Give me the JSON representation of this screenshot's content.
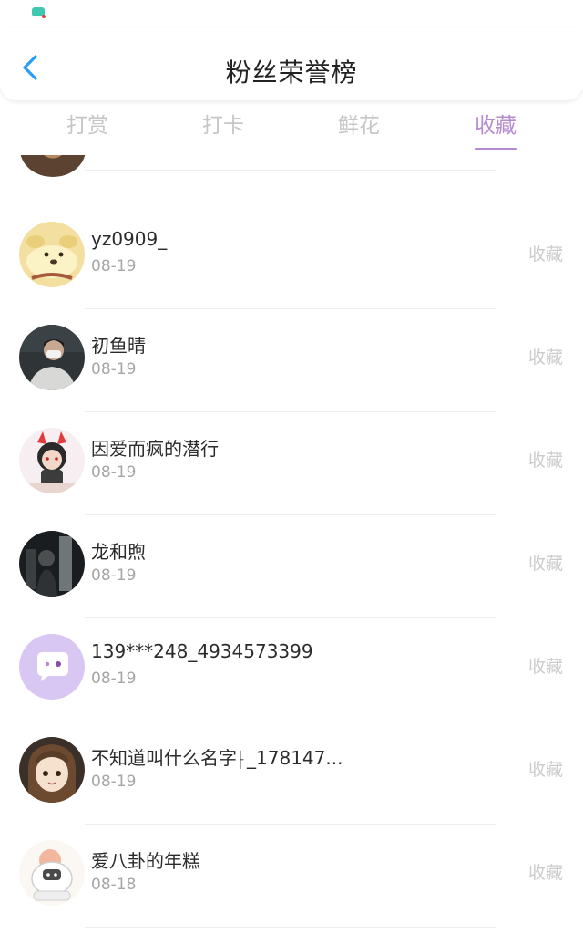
{
  "header": {
    "title": "粉丝荣誉榜"
  },
  "tabs": [
    {
      "label": "打赏",
      "active": false
    },
    {
      "label": "打卡",
      "active": false
    },
    {
      "label": "鲜花",
      "active": false
    },
    {
      "label": "收藏",
      "active": true
    }
  ],
  "colors": {
    "accent": "#b68ad0",
    "tab_inactive": "#c6c6c6",
    "date_text": "#a6a6a6",
    "action_text": "#cccccc"
  },
  "list": {
    "items": [
      {
        "name": "yz0909_",
        "date": "08-19",
        "action": "收藏",
        "avatar": "cartoon-dog-avatar"
      },
      {
        "name": "初鱼晴",
        "date": "08-19",
        "action": "收藏",
        "avatar": "masked-person-avatar"
      },
      {
        "name": "因爱而疯的潜行",
        "date": "08-19",
        "action": "收藏",
        "avatar": "devil-horn-avatar"
      },
      {
        "name": "龙和煦",
        "date": "08-19",
        "action": "收藏",
        "avatar": "dark-photo-avatar"
      },
      {
        "name": "139***248_4934573399",
        "date": "08-19",
        "action": "收藏",
        "avatar": "default-chat-avatar"
      },
      {
        "name": "不知道叫什么名字⸠_178147...",
        "date": "08-19",
        "action": "收藏",
        "avatar": "anime-girl-avatar"
      },
      {
        "name": "爱八卦的年糕",
        "date": "08-18",
        "action": "收藏",
        "avatar": "cartoon-astronaut-avatar"
      }
    ]
  }
}
